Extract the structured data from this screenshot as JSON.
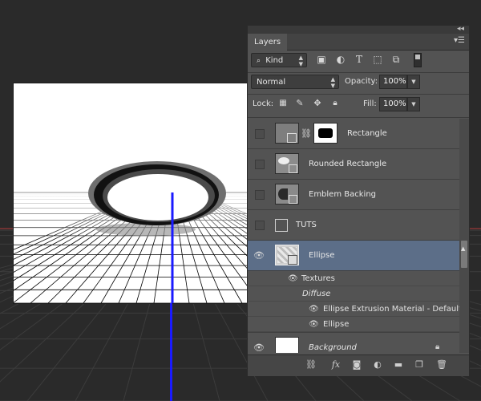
{
  "panel": {
    "tab": "Layers",
    "filter": {
      "label": "Kind",
      "icons": [
        "image-filter-icon",
        "adjustment-filter-icon",
        "type-filter-icon",
        "shape-filter-icon",
        "smart-object-filter-icon",
        "filter-toggle-icon"
      ]
    },
    "blend_mode": "Normal",
    "opacity_label": "Opacity:",
    "opacity_value": "100%",
    "lock_label": "Lock:",
    "fill_label": "Fill:",
    "fill_value": "100%"
  },
  "layers": [
    {
      "name": "Rectangle",
      "visible": false,
      "selected": false
    },
    {
      "name": "Rounded Rectangle",
      "visible": false,
      "selected": false
    },
    {
      "name": "Emblem Backing",
      "visible": false,
      "selected": false
    },
    {
      "name": "TUTS",
      "visible": false,
      "selected": false
    },
    {
      "name": "Ellipse",
      "visible": true,
      "selected": true
    },
    {
      "name": "Background",
      "visible": true,
      "selected": false
    }
  ],
  "ellipse_sub": {
    "textures": "Textures",
    "diffuse": "Diffuse",
    "material": "Ellipse Extrusion Material - Default...",
    "ellipse": "Ellipse"
  },
  "footer_icons": [
    "link-layers-icon",
    "layer-style-icon",
    "layer-mask-icon",
    "adjustment-layer-icon",
    "new-group-icon",
    "new-layer-icon",
    "delete-layer-icon"
  ],
  "colors": {
    "panel": "#535353",
    "selection": "#5c6e88",
    "axis_blue": "#1a1aff",
    "axis_red": "#c83232"
  }
}
